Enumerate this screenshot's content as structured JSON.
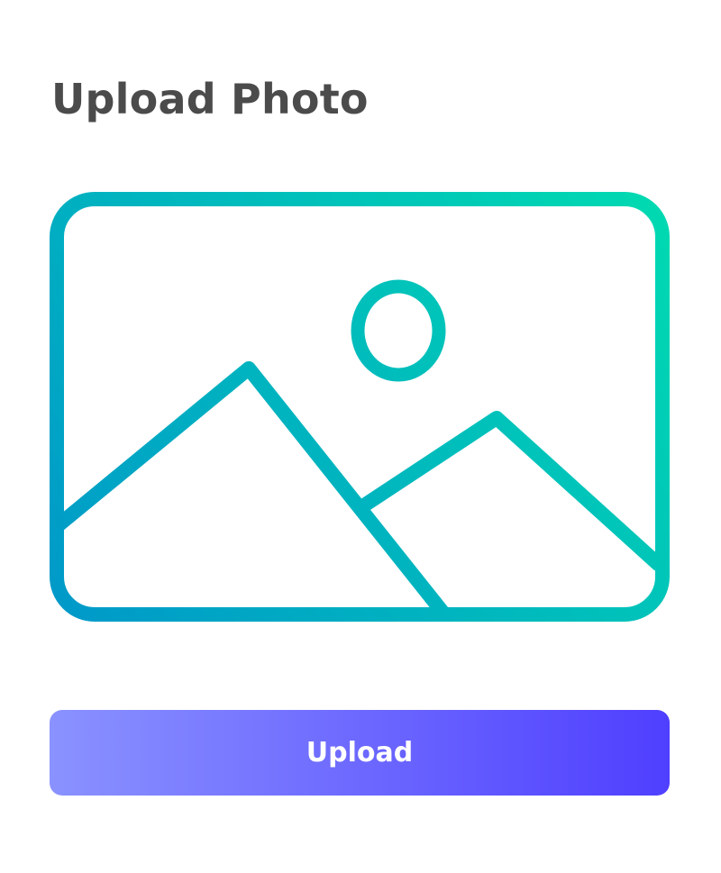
{
  "page": {
    "title": "Upload Photo"
  },
  "placeholder": {
    "icon": "image-placeholder-icon",
    "gradient_top": "#00d8b2",
    "gradient_bottom": "#0099c9"
  },
  "upload_button": {
    "label": "Upload",
    "gradient_left": "#8a92ff",
    "gradient_right": "#4f3fff"
  }
}
